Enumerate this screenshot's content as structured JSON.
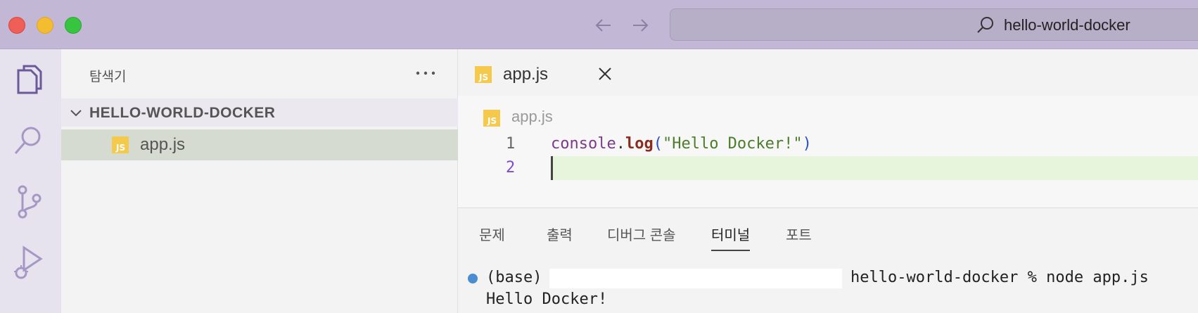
{
  "window": {
    "search_text": "hello-world-docker"
  },
  "sidebar": {
    "title": "탐색기",
    "folder": "HELLO-WORLD-DOCKER",
    "files": [
      {
        "name": "app.js",
        "icon": "JS"
      }
    ]
  },
  "editor": {
    "tab_label": "app.js",
    "tab_icon": "JS",
    "breadcrumb": "app.js",
    "lines": [
      {
        "num": "1",
        "tokens": {
          "obj": "console",
          "dot": ".",
          "fn": "log",
          "open": "(",
          "str": "\"Hello Docker!\"",
          "close": ")"
        }
      },
      {
        "num": "2",
        "tokens": {}
      }
    ]
  },
  "panel": {
    "tabs": [
      "문제",
      "출력",
      "디버그 콘솔",
      "터미널",
      "포트"
    ],
    "active_tab": "터미널",
    "terminal": {
      "line1_prefix": "(base)",
      "line1_suffix": "hello-world-docker % node app.js",
      "line2": "Hello Docker!"
    }
  },
  "colors": {
    "titlebar": "#c2b8d6",
    "js_icon": "#f5c94b",
    "active_line": "#e8f5dd",
    "selected_file": "#d6dbd1"
  }
}
